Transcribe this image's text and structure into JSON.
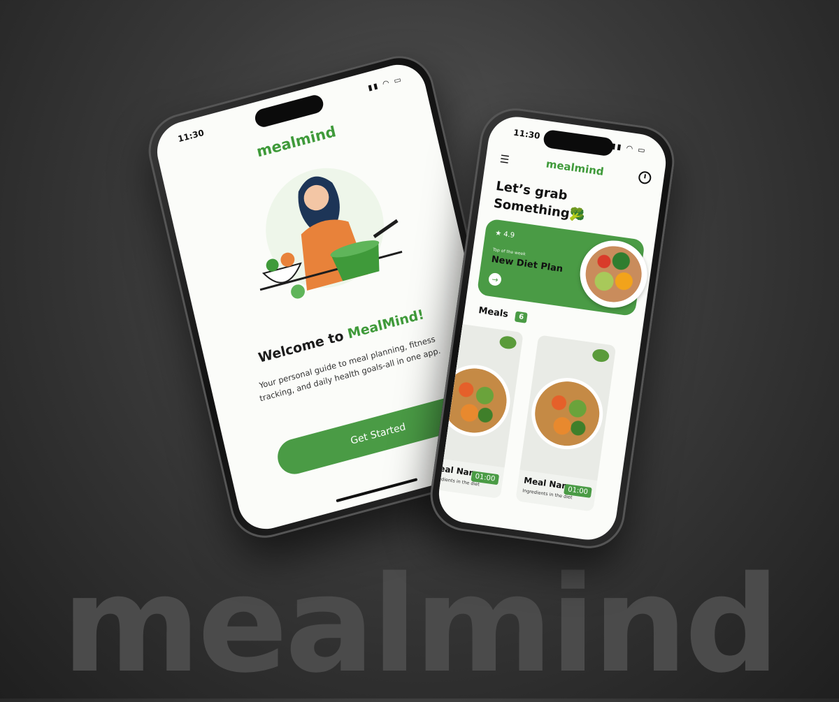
{
  "brand": {
    "watermark": "mealmind",
    "accent": "#4a9b45"
  },
  "welcome_screen": {
    "time": "11:30",
    "logo": "mealmind",
    "title_prefix": "Welcome to",
    "title_brand": "MealMind!",
    "description": "Your personal guide to meal planning, fitness tracking, and daily health goals-all in one app.",
    "cta_label": "Get Started"
  },
  "home_screen": {
    "time": "11:30",
    "logo": "mealmind",
    "heading_line1": "Let’s grab",
    "heading_line2": "Something🥦",
    "promo": {
      "rating": "4.9",
      "kicker": "Top of the week",
      "name": "New Diet Plan"
    },
    "meals_label": "Meals",
    "meals_count": "6",
    "cards": [
      {
        "name": "Meal Name",
        "desc": "Ingredients in the diet",
        "timer": "01:00"
      },
      {
        "name": "Meal Name",
        "desc": "Ingredients in the diet",
        "timer": "01:00"
      }
    ]
  }
}
